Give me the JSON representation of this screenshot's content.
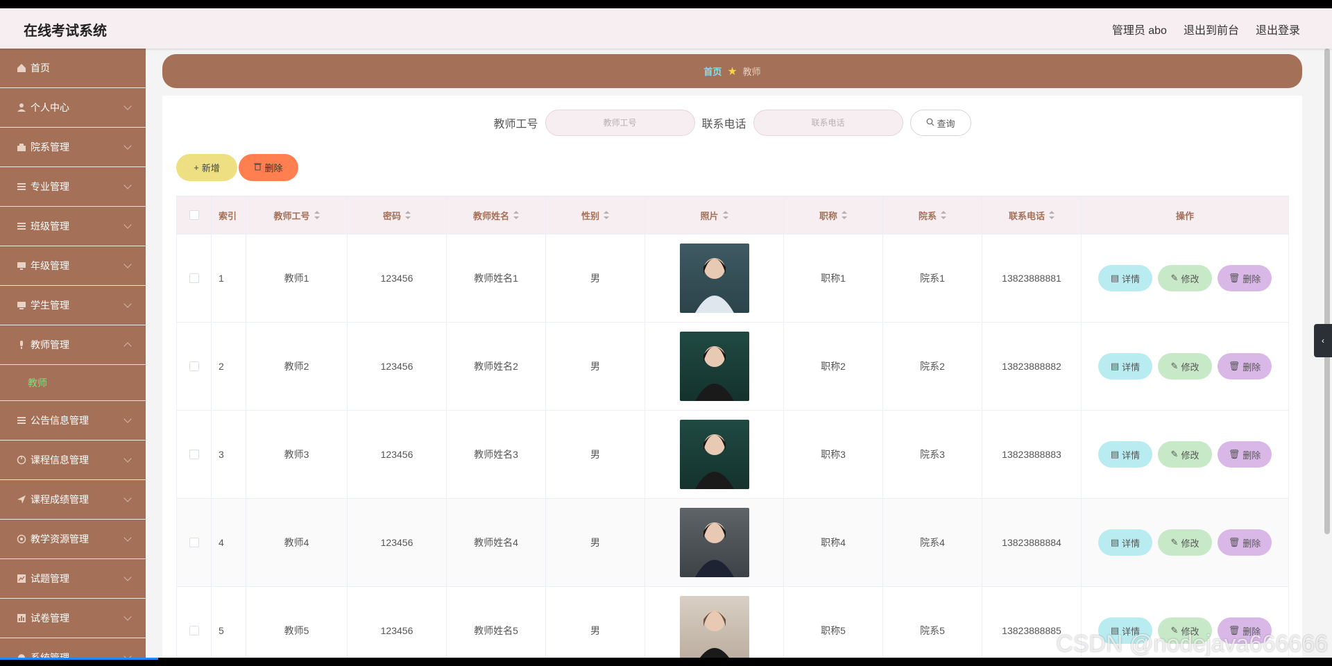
{
  "header": {
    "title": "在线考试系统",
    "user": "管理员 abo",
    "to_front": "退出到前台",
    "logout": "退出登录"
  },
  "sidebar": {
    "items": [
      {
        "label": "首页",
        "icon": "home-icon"
      },
      {
        "label": "个人中心",
        "icon": "user-icon"
      },
      {
        "label": "院系管理",
        "icon": "department-icon"
      },
      {
        "label": "专业管理",
        "icon": "major-icon"
      },
      {
        "label": "班级管理",
        "icon": "class-icon"
      },
      {
        "label": "年级管理",
        "icon": "grade-icon"
      },
      {
        "label": "学生管理",
        "icon": "student-icon"
      },
      {
        "label": "教师管理",
        "icon": "teacher-icon"
      }
    ],
    "active_sub": "教师",
    "items2": [
      {
        "label": "公告信息管理",
        "icon": "notice-icon"
      },
      {
        "label": "课程信息管理",
        "icon": "course-icon"
      },
      {
        "label": "课程成绩管理",
        "icon": "score-icon"
      },
      {
        "label": "教学资源管理",
        "icon": "resource-icon"
      },
      {
        "label": "试题管理",
        "icon": "question-icon"
      },
      {
        "label": "试卷管理",
        "icon": "paper-icon"
      },
      {
        "label": "系统管理",
        "icon": "system-icon"
      }
    ]
  },
  "breadcrumb": {
    "home": "首页",
    "current": "教师"
  },
  "search": {
    "field1_label": "教师工号",
    "field1_placeholder": "教师工号",
    "field2_label": "联系电话",
    "field2_placeholder": "联系电话",
    "query": "查询"
  },
  "toolbar": {
    "add": "新增",
    "delete": "删除"
  },
  "table": {
    "columns": [
      "索引",
      "教师工号",
      "密码",
      "教师姓名",
      "性别",
      "照片",
      "职称",
      "院系",
      "联系电话",
      "操作"
    ],
    "ops": {
      "detail": "详情",
      "edit": "修改",
      "delete": "删除"
    },
    "rows": [
      {
        "index": "1",
        "id": "教师1",
        "password": "123456",
        "name": "教师姓名1",
        "gender": "男",
        "title": "职称1",
        "dept": "院系1",
        "phone": "13823888881"
      },
      {
        "index": "2",
        "id": "教师2",
        "password": "123456",
        "name": "教师姓名2",
        "gender": "男",
        "title": "职称2",
        "dept": "院系2",
        "phone": "13823888882"
      },
      {
        "index": "3",
        "id": "教师3",
        "password": "123456",
        "name": "教师姓名3",
        "gender": "男",
        "title": "职称3",
        "dept": "院系3",
        "phone": "13823888883"
      },
      {
        "index": "4",
        "id": "教师4",
        "password": "123456",
        "name": "教师姓名4",
        "gender": "男",
        "title": "职称4",
        "dept": "院系4",
        "phone": "13823888884"
      },
      {
        "index": "5",
        "id": "教师5",
        "password": "123456",
        "name": "教师姓名5",
        "gender": "男",
        "title": "职称5",
        "dept": "院系5",
        "phone": "13823888885"
      }
    ]
  },
  "watermark": "CSDN @nodejava666666",
  "colors": {
    "sidebar": "#a47058",
    "accent_green": "#7ee07e",
    "header_bg": "#f6eef0"
  }
}
